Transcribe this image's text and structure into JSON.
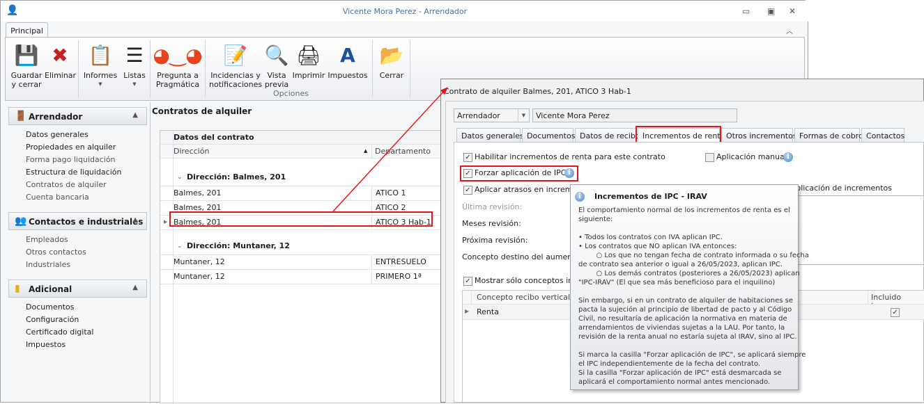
{
  "window": {
    "title": "Vicente Mora Perez - Arrendador"
  },
  "ribbon": {
    "tab": "Principal",
    "buttons": {
      "guardar": "Guardar\ny cerrar",
      "eliminar": "Eliminar",
      "informes": "Informes",
      "listas": "Listas",
      "pregunta": "Pregunta a\nPragmática",
      "incidencias": "Incidencias y\nnotificaciones",
      "vista": "Vista\nprevia",
      "imprimir": "Imprimir",
      "impuestos": "Impuestos",
      "cerrar": "Cerrar"
    },
    "group_opciones": "Opciones"
  },
  "sidebar": {
    "arrendador": {
      "title": "Arrendador",
      "items": [
        "Datos generales",
        "Propiedades en alquiler",
        "Forma pago liquidación",
        "Estructura de liquidación",
        "Contratos de alquiler",
        "Cuenta bancaria"
      ]
    },
    "contactos": {
      "title": "Contactos e industriales",
      "items": [
        "Empleados",
        "Otros contactos",
        "Industriales"
      ]
    },
    "adicional": {
      "title": "Adicional",
      "items": [
        "Documentos",
        "Configuración",
        "Certificado digital",
        "Impuestos"
      ]
    }
  },
  "contracts": {
    "title": "Contratos de alquiler",
    "band": "Datos del contrato",
    "columns": [
      "Dirección",
      "Departamento"
    ],
    "groups": [
      {
        "label": "Dirección: Balmes, 201",
        "rows": [
          [
            "Balmes, 201",
            "ATICO 1"
          ],
          [
            "Balmes, 201",
            "ATICO 2"
          ],
          [
            "Balmes, 201",
            "ATICO 3 Hab-1"
          ]
        ]
      },
      {
        "label": "Dirección: Muntaner, 12",
        "rows": [
          [
            "Muntaner, 12",
            "ENTRESUELO"
          ],
          [
            "Muntaner, 12",
            "PRIMERO 1ª"
          ]
        ]
      }
    ]
  },
  "dialog": {
    "title": "Contrato de alquiler Balmes, 201, ATICO 3 Hab-1",
    "combo": "Arrendador",
    "name": "Vicente Mora Perez",
    "tabs": [
      "Datos generales",
      "Documentos",
      "Datos de recibo",
      "Incrementos de renta",
      "Otros incrementos",
      "Formas de cobro",
      "Contactos"
    ],
    "active_tab": "Incrementos de renta",
    "checks": {
      "habilitar": "Habilitar incrementos de renta para este contrato",
      "forzar": "Forzar aplicación de IPC",
      "atrasos": "Aplicar atrasos en incrementos",
      "manual": "Aplicación manual",
      "mostrar": "Mostrar sólo conceptos incluidos"
    },
    "check_states": {
      "habilitar": true,
      "forzar": true,
      "atrasos": true,
      "manual": false,
      "mostrar": true
    },
    "observaciones": "Observaciones para la aplicación de incrementos",
    "labels": {
      "ultima": "Última revisión:",
      "meses": "Meses revisión:",
      "proxima": "Próxima revisión:",
      "concepto": "Concepto destino del aumento:"
    },
    "grid": {
      "columns": [
        "Concepto recibo vertical",
        "Incluido incr..."
      ],
      "rows": [
        {
          "concepto": "Renta",
          "incluido": true
        }
      ]
    }
  },
  "tooltip": {
    "title": "Incrementos de IPC - IRAV",
    "lines": [
      "El comportamiento normal de los incrementos de renta es el",
      "siguiente:",
      "",
      "• Todos los contratos con IVA aplican IPC.",
      "• Los contratos que NO aplican IVA entonces:",
      "        ○ Los que no tengan fecha de contrato informada o su fecha",
      "de contrato sea anterior o igual a 26/05/2023, aplican IPC.",
      "        ○ Los demás contratos (posteriores a 26/05/2023) aplican",
      "\"IPC-IRAV\" (El que sea más beneficioso para el inquilino)",
      "",
      "Sin embargo, si en un contrato de alquiler de habitaciones se",
      "pacta la sujeción al principio de libertad de pacto y al Código",
      "Civil, no resultaría de aplicación la normativa en materia de",
      "arrendamientos de viviendas sujetas a la LAU. Por tanto, la",
      "revisión de la renta anual no estaría sujeta al IRAV, sino al IPC.",
      "",
      "Si marca la casilla \"Forzar aplicación de IPC\", se aplicará siempre",
      "el IPC independientemente de la fecha del contrato.",
      "Si la casilla \"Forzar aplicación de IPC\" está desmarcada se",
      "aplicará el comportamiento normal antes mencionado."
    ]
  },
  "colors": {
    "highlight": "#e8141b",
    "accent": "#4a6fa5"
  }
}
